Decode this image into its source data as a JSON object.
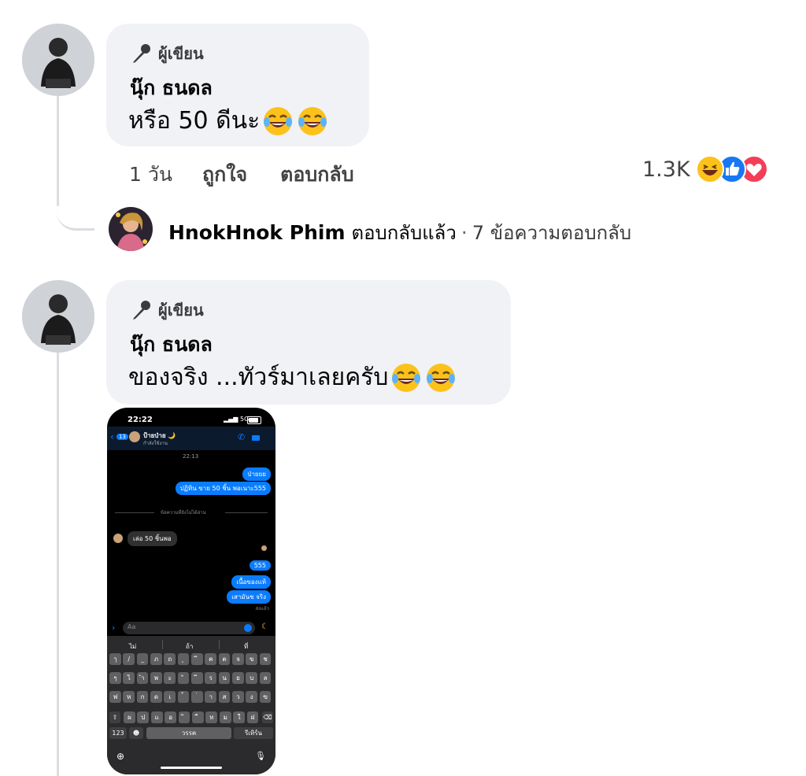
{
  "comments": [
    {
      "badge": "ผู้เขียน",
      "author": "นุ๊ก ธนดล",
      "text": "หรือ 50 ดีนะ",
      "emojis": [
        "face-with-tears-of-joy",
        "face-with-tears-of-joy"
      ],
      "time": "1 วัน",
      "like_label": "ถูกใจ",
      "reply_label": "ตอบกลับ",
      "reaction_count": "1.3K",
      "reactions": [
        "haha",
        "like",
        "love"
      ]
    },
    {
      "badge": "ผู้เขียน",
      "author": "นุ๊ก ธนดล",
      "text": "ของจริง ...ทัวร์มาเลยครับ",
      "emojis": [
        "face-with-tears-of-joy",
        "face-with-tears-of-joy"
      ]
    }
  ],
  "reply_summary": {
    "name": "HnokHnok Phim",
    "action": "ตอบกลับแล้ว",
    "separator": "·",
    "count_text": "7 ข้อความตอบกลับ"
  },
  "phone": {
    "time": "22:22",
    "signal": "5G",
    "back_count": "13",
    "contact_name": "ป้ายป่าย 🌙",
    "contact_status": "กำลังใช้งาน",
    "timestamp": "22:13",
    "unread_divider": "ข้อความที่ยังไม่ได้อ่าน",
    "messages_sent_1": [
      "ป่ายยย",
      "ปฏิทิน ขาย 50 ชิ้น พอเนาะ555"
    ],
    "message_received": "เล่อ 50 ชิ้นพอ",
    "messages_sent_2": [
      "555",
      "เนื้อของแท้",
      "เสามันช จริง"
    ],
    "read_label": "ส่งแล้ว",
    "input_placeholder": "Aa",
    "suggestions": [
      "ไม่",
      "ถ้า",
      "ที่"
    ],
    "keyboard_rows": [
      [
        "ๅ",
        "/",
        "_",
        "ภ",
        "ถ",
        "ุ",
        "ึ",
        "ค",
        "ต",
        "จ",
        "ข",
        "ช"
      ],
      [
        "ๆ",
        "ไ",
        "ำ",
        "พ",
        "ะ",
        "ั",
        "ี",
        "ร",
        "น",
        "ย",
        "บ",
        "ล"
      ],
      [
        "ฟ",
        "ห",
        "ก",
        "ด",
        "เ",
        "้",
        "่",
        "า",
        "ส",
        "ว",
        "ง",
        "ฃ"
      ],
      [
        "ผ",
        "ป",
        "แ",
        "อ",
        "ิ",
        "ื",
        "ท",
        "ม",
        "ใ",
        "ฝ"
      ]
    ],
    "key_123": "123",
    "space_label": "วรรค",
    "return_label": "รีเทิร์น"
  }
}
